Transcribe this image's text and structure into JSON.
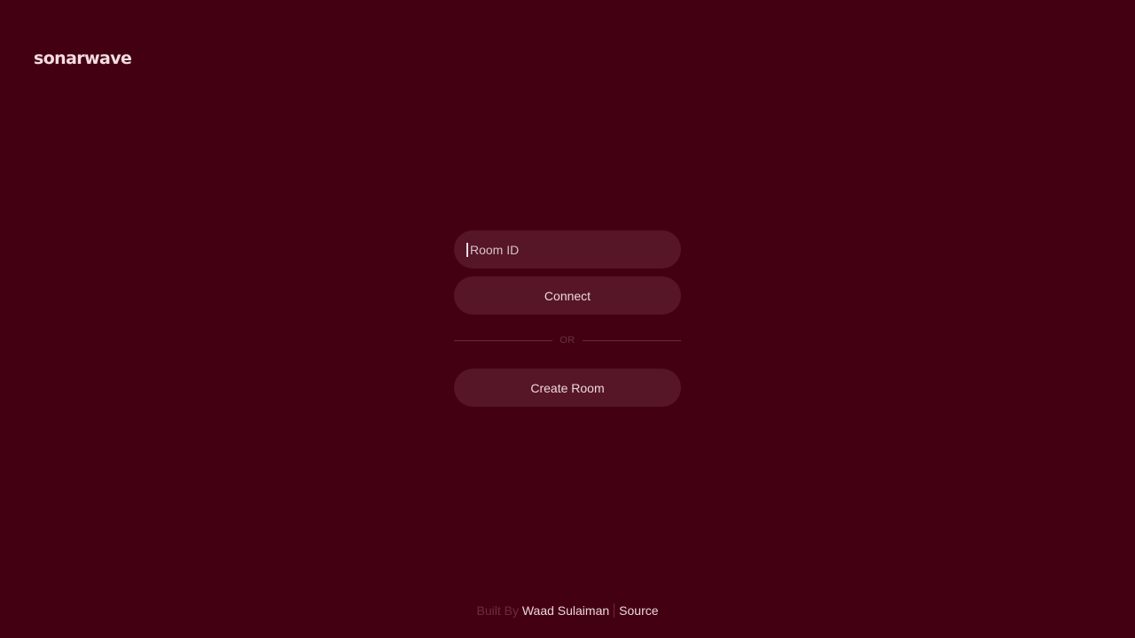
{
  "app": {
    "logo_text": "sonarwave"
  },
  "form": {
    "room_id_placeholder": "Room ID",
    "room_id_value": "",
    "connect_label": "Connect",
    "divider_text": "OR",
    "create_room_label": "Create Room"
  },
  "footer": {
    "built_by_prefix": "Built By",
    "author_name": "Waad Sulaiman",
    "source_label": "Source"
  },
  "colors": {
    "background": "#440013",
    "control_fill": "#561627",
    "text_light": "#ecd8dd",
    "text_muted": "#6e2b3e"
  }
}
